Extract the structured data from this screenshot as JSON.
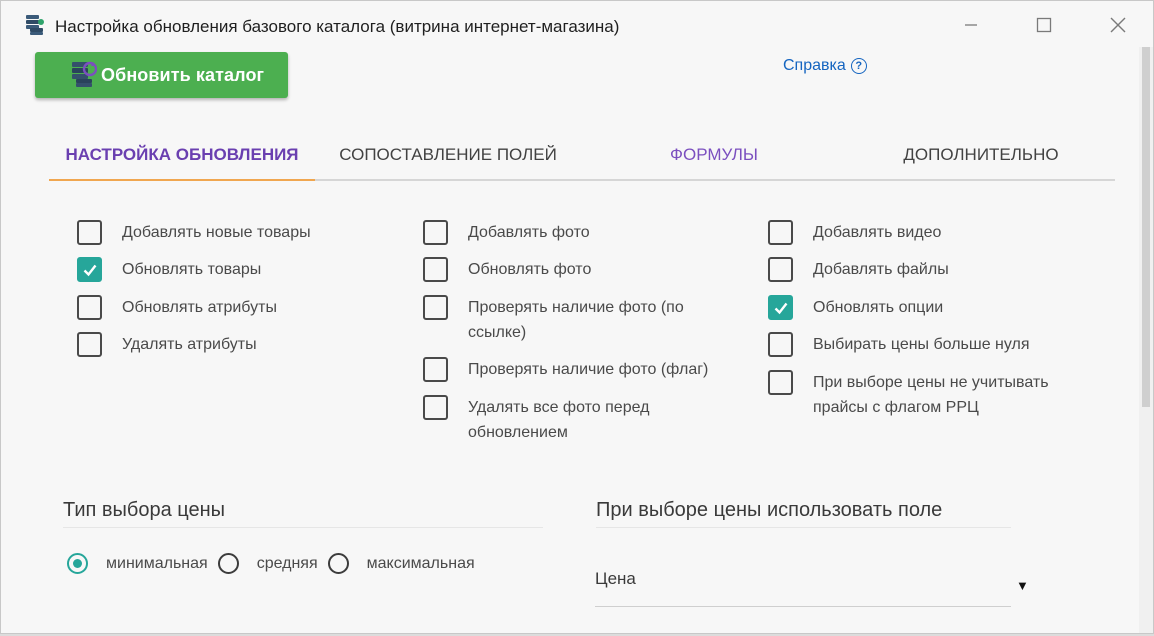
{
  "window": {
    "title": "Настройка обновления базового каталога (витрина интернет-магазина)",
    "icon": "catalog-db-icon"
  },
  "toolbar": {
    "update_label": "Обновить каталог",
    "update_icon": "database-refresh-icon",
    "help_label": "Справка",
    "help_icon_glyph": "?"
  },
  "tabs": [
    {
      "label": "НАСТРОЙКА ОБНОВЛЕНИЯ",
      "active": true
    },
    {
      "label": "СОПОСТАВЛЕНИЕ ПОЛЕЙ",
      "active": false
    },
    {
      "label": "ФОРМУЛЫ",
      "active": false
    },
    {
      "label": "ДОПОЛНИТЕЛЬНО",
      "active": false
    }
  ],
  "options": {
    "col1": [
      {
        "label": "Добавлять новые товары",
        "checked": false
      },
      {
        "label": "Обновлять товары",
        "checked": true
      },
      {
        "label": "Обновлять атрибуты",
        "checked": false
      },
      {
        "label": "Удалять атрибуты",
        "checked": false
      }
    ],
    "col2": [
      {
        "label": "Добавлять фото",
        "checked": false
      },
      {
        "label": "Обновлять фото",
        "checked": false
      },
      {
        "label": "Проверять наличие фото (по ссылке)",
        "checked": false
      },
      {
        "label": "Проверять наличие фото (флаг)",
        "checked": false
      },
      {
        "label": "Удалять все фото перед обновлением",
        "checked": false
      }
    ],
    "col3": [
      {
        "label": "Добавлять видео",
        "checked": false
      },
      {
        "label": "Добавлять файлы",
        "checked": false
      },
      {
        "label": "Обновлять опции",
        "checked": true
      },
      {
        "label": "Выбирать цены больше нуля",
        "checked": false
      },
      {
        "label": "При выборе цены не учитывать прайсы с флагом РРЦ",
        "checked": false
      }
    ]
  },
  "price_type": {
    "title": "Тип выбора цены",
    "options": [
      {
        "label": "минимальная",
        "selected": true
      },
      {
        "label": "средняя",
        "selected": false
      },
      {
        "label": "максимальная",
        "selected": false
      }
    ]
  },
  "price_field": {
    "title": "При выборе цены использовать поле",
    "value": "Цена"
  },
  "colors": {
    "accent_green": "#4caf50",
    "checkbox_teal": "#26a69a",
    "tab_active": "#6a3fb0",
    "tab_indicator": "#f0a64f",
    "link": "#1565c0"
  }
}
